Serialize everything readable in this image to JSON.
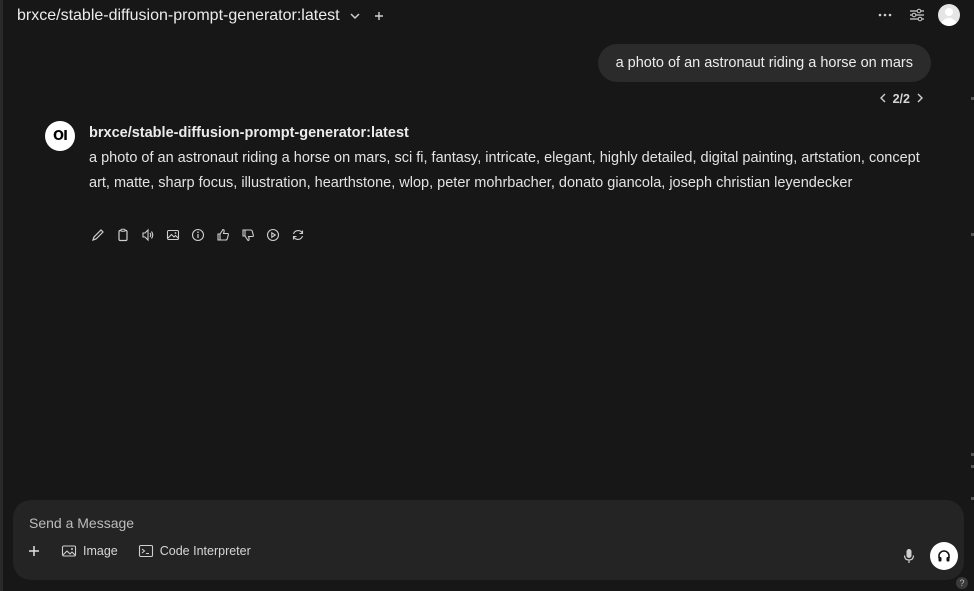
{
  "header": {
    "model_name": "brxce/stable-diffusion-prompt-generator:latest",
    "icons": [
      "chevron-down-icon",
      "plus-icon",
      "more-icon",
      "controls-icon",
      "avatar"
    ]
  },
  "user_message": {
    "text": "a photo of an astronaut riding a horse on mars",
    "pager": "2/2"
  },
  "assistant": {
    "avatar_text": "OI",
    "name": "brxce/stable-diffusion-prompt-generator:latest",
    "text": "a photo of an astronaut riding a horse on mars, sci fi, fantasy, intricate, elegant, highly detailed, digital painting, artstation, concept art, matte, sharp focus, illustration, hearthstone, wlop, peter mohrbacher, donato giancola, joseph christian leyendecker",
    "actions": [
      "edit-icon",
      "copy-icon",
      "speak-icon",
      "image-icon",
      "info-icon",
      "thumbs-up-icon",
      "thumbs-down-icon",
      "continue-icon",
      "regenerate-icon"
    ]
  },
  "composer": {
    "placeholder": "Send a Message",
    "image_label": "Image",
    "code_label": "Code Interpreter",
    "help": "?"
  },
  "colors": {
    "background": "#171717",
    "bubble": "#2b2b2b",
    "composer": "#242424",
    "text": "#ececec"
  }
}
